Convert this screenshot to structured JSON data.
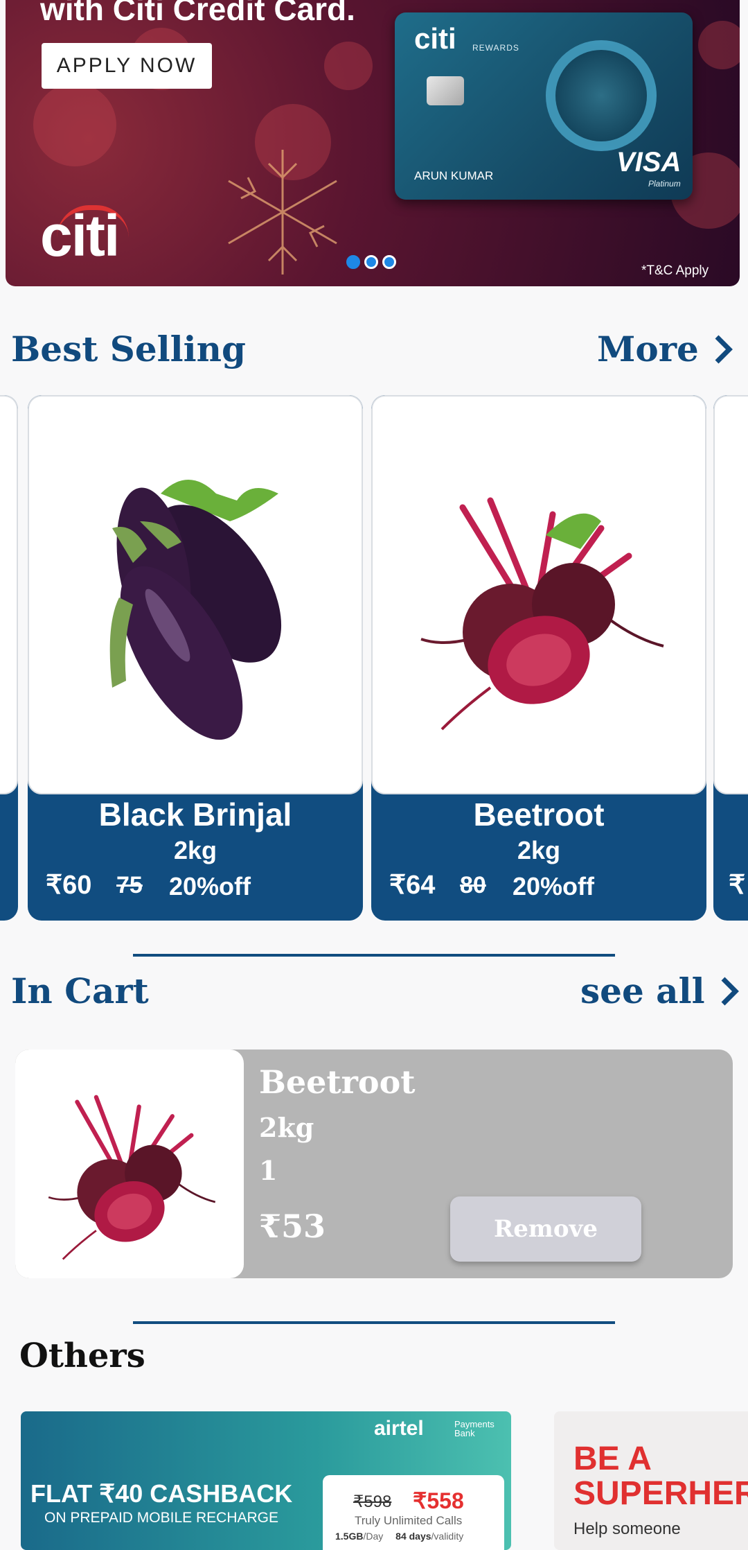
{
  "banner": {
    "headline": "with Citi Credit Card.",
    "cta_label": "APPLY NOW",
    "card_brand": "citi",
    "card_brand_sub": "REWARDS",
    "card_holder": "ARUN KUMAR",
    "card_network": "VISA",
    "card_tier": "Platinum",
    "logo_text": "citi",
    "terms": "*T&C Apply",
    "slides_total": 3,
    "active_slide": 1,
    "colors": {
      "active_dot": "#1e88e5",
      "inactive_dot": "#ffffff"
    }
  },
  "best_selling": {
    "title": "Best Selling",
    "more_label": "More",
    "products": [
      {
        "name": "Black Brinjal",
        "qty": "2kg",
        "price": "₹60",
        "mrp": "75",
        "discount": "20%off",
        "image": "brinjal-image"
      },
      {
        "name": "Beetroot",
        "qty": "2kg",
        "price": "₹64",
        "mrp": "80",
        "discount": "20%off",
        "image": "beetroot-image"
      }
    ],
    "partial_next_price": "₹"
  },
  "in_cart": {
    "title": "In Cart",
    "see_all_label": "see all",
    "items": [
      {
        "name": "Beetroot",
        "qty": "2kg",
        "count": "1",
        "price": "₹53",
        "remove_label": "Remove"
      }
    ]
  },
  "others": {
    "title": "Others",
    "promos": [
      {
        "brand": "airtel",
        "brand_sub": "Payments Bank",
        "headline": "FLAT ₹40 CASHBACK",
        "sub": "ON PREPAID MOBILE RECHARGE",
        "old_price": "₹598",
        "new_price": "₹558",
        "note": "Truly Unlimited Calls",
        "detail_data": "1.5GB",
        "detail_per": "/Day",
        "detail_days": "84 days",
        "detail_validity": "/validity"
      },
      {
        "headline_line1": "BE A",
        "headline_line2": "SUPERHER",
        "sub": "Help someone"
      }
    ]
  },
  "theme": {
    "primary": "#114d80",
    "cart_bg": "#b5b5b5"
  }
}
